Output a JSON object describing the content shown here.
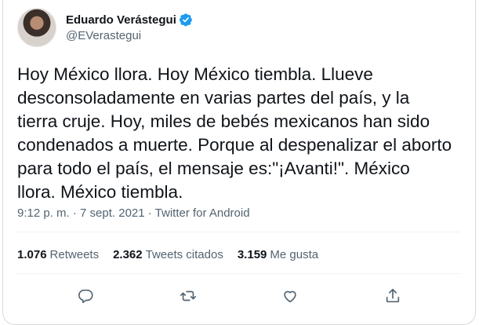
{
  "author": {
    "display_name": "Eduardo Verástegui",
    "handle": "@EVerastegui"
  },
  "tweet": {
    "text": "Hoy México llora. Hoy México tiembla. Llueve\ndesconsoladamente en varias partes del país, y la\ntierra cruje. Hoy, miles de bebés mexicanos han sido\ncondenados a muerte. Porque al despenalizar el aborto\npara todo el país, el mensaje es:\"¡Avanti!\". México\nllora. México tiembla.",
    "timestamp": "9:12 p. m. · 7 sept. 2021 · Twitter for Android"
  },
  "stats": {
    "retweets_count": "1.076",
    "retweets_label": "Retweets",
    "quotes_count": "2.362",
    "quotes_label": "Tweets citados",
    "likes_count": "3.159",
    "likes_label": "Me gusta"
  },
  "colors": {
    "verified": "#1d9bf0",
    "secondary_text": "#536471",
    "primary_text": "#0f1419",
    "divider": "#eff3f4"
  },
  "icons": [
    "reply-icon",
    "retweet-icon",
    "like-icon",
    "share-icon",
    "verified-badge-icon"
  ]
}
